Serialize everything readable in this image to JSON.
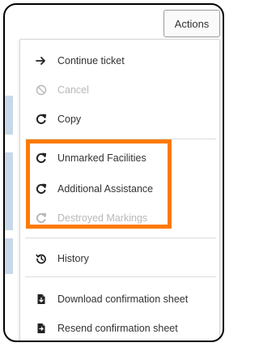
{
  "header": {
    "actions_label": "Actions"
  },
  "menu": {
    "items": [
      {
        "label": "Continue ticket",
        "icon": "arrow-right-icon",
        "disabled": false
      },
      {
        "label": "Cancel",
        "icon": "cancel-icon",
        "disabled": true
      },
      {
        "label": "Copy",
        "icon": "copy-refresh-icon",
        "disabled": false
      },
      {
        "label": "Unmarked Facilities",
        "icon": "copy-refresh-icon",
        "disabled": false
      },
      {
        "label": "Additional Assistance",
        "icon": "copy-refresh-icon",
        "disabled": false
      },
      {
        "label": "Destroyed Markings",
        "icon": "copy-refresh-icon",
        "disabled": true
      },
      {
        "label": "History",
        "icon": "history-icon",
        "disabled": false
      },
      {
        "label": "Download confirmation sheet",
        "icon": "file-download-icon",
        "disabled": false
      },
      {
        "label": "Resend confirmation sheet",
        "icon": "file-send-icon",
        "disabled": false
      }
    ]
  },
  "colors": {
    "highlight": "#ff7a00",
    "disabled_text": "#b8b8b8",
    "text": "#333333"
  }
}
